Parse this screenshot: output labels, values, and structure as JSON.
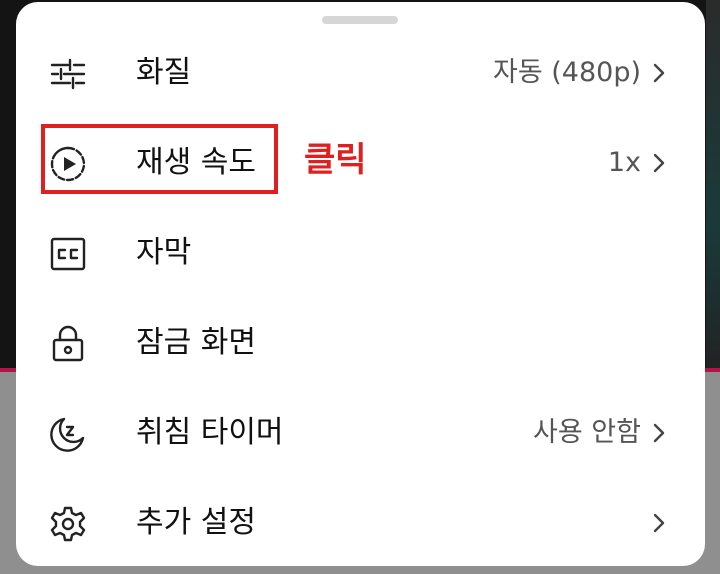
{
  "menu": {
    "items": [
      {
        "label": "화질",
        "value": "자동 (480p)",
        "icon": "tune-sliders-icon",
        "has_chevron": true
      },
      {
        "label": "재생 속도",
        "value": "1x",
        "icon": "playback-speed-icon",
        "has_chevron": true
      },
      {
        "label": "자막",
        "value": "",
        "icon": "closed-captions-icon",
        "has_chevron": false
      },
      {
        "label": "잠금 화면",
        "value": "",
        "icon": "lock-icon",
        "has_chevron": false
      },
      {
        "label": "취침 타이머",
        "value": "사용 안함",
        "icon": "sleep-moon-icon",
        "has_chevron": true
      },
      {
        "label": "추가 설정",
        "value": "",
        "icon": "gear-icon",
        "has_chevron": true
      }
    ]
  },
  "annotation": {
    "text": "클릭",
    "color": "#e02020"
  },
  "colors": {
    "sheet_background": "#ffffff",
    "label_text": "#111111",
    "value_text": "#555555",
    "highlight": "#e02020"
  }
}
